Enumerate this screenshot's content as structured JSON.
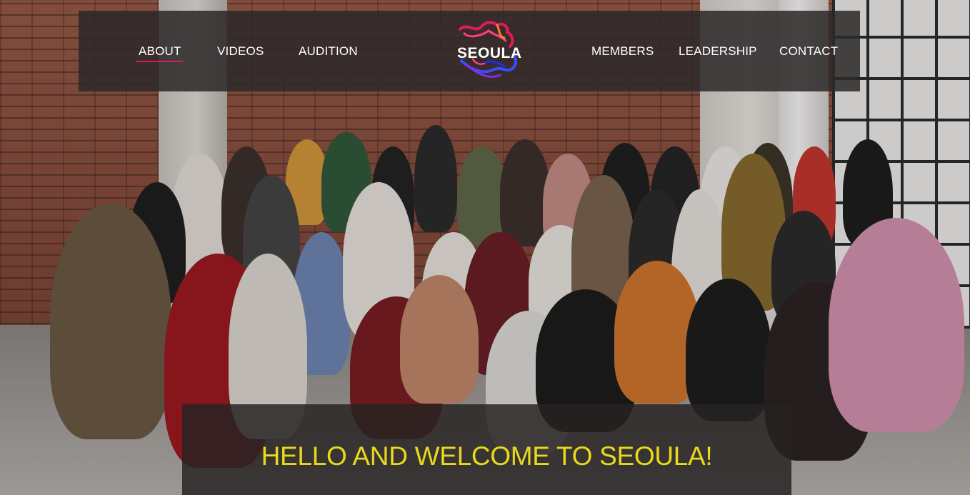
{
  "nav": {
    "left_links": [
      {
        "label": "ABOUT",
        "active": true
      },
      {
        "label": "VIDEOS",
        "active": false
      },
      {
        "label": "AUDITION",
        "active": false
      }
    ],
    "right_links": [
      {
        "label": "MEMBERS",
        "active": false
      },
      {
        "label": "LEADERSHIP",
        "active": false
      },
      {
        "label": "CONTACT",
        "active": false
      }
    ],
    "logo_text": "SEOULA"
  },
  "hero": {
    "welcome": "HELLO AND WELCOME TO SEOULA!",
    "image_icon": "group-photo-image"
  },
  "colors": {
    "nav_background": "#2c2929",
    "active_underline": "#e2195b",
    "welcome_text": "#e9d91c",
    "nav_text": "#ffffff"
  }
}
